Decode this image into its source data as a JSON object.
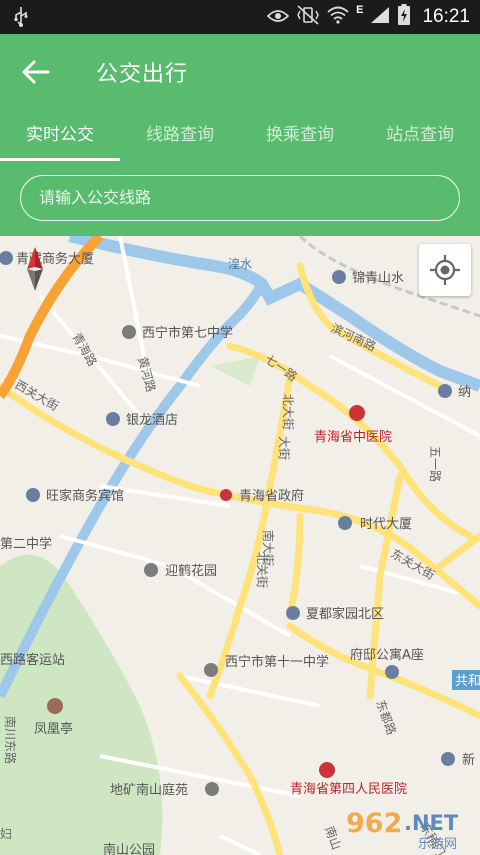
{
  "status_bar": {
    "time": "16:21",
    "network_label": "E",
    "icons": [
      "usb-icon",
      "eye-icon",
      "vibrate-icon",
      "wifi-icon",
      "signal-icon",
      "battery-charging-icon"
    ]
  },
  "header": {
    "back_icon": "back-arrow-icon",
    "title": "公交出行"
  },
  "tabs": [
    {
      "label": "实时公交",
      "active": true
    },
    {
      "label": "线路查询",
      "active": false
    },
    {
      "label": "换乘查询",
      "active": false
    },
    {
      "label": "站点查询",
      "active": false
    }
  ],
  "search": {
    "value": "",
    "placeholder": "请输入公交线路"
  },
  "map": {
    "locate_icon": "gps-locate-icon",
    "compass_icon": "compass-icon",
    "pois": [
      {
        "name": "青藏商务大厦",
        "type": "building"
      },
      {
        "name": "锦青山水",
        "type": "building"
      },
      {
        "name": "西宁市第七中学",
        "type": "school"
      },
      {
        "name": "银龙酒店",
        "type": "hotel"
      },
      {
        "name": "纳",
        "type": "hotel"
      },
      {
        "name": "青海省中医院",
        "type": "hospital"
      },
      {
        "name": "旺家商务宾馆",
        "type": "hotel"
      },
      {
        "name": "青海省政府",
        "type": "government"
      },
      {
        "name": "时代大厦",
        "type": "building"
      },
      {
        "name": "第二中学",
        "type": "school"
      },
      {
        "name": "迎鹤花园",
        "type": "residential"
      },
      {
        "name": "夏都家园北区",
        "type": "residential"
      },
      {
        "name": "府邸公寓A座",
        "type": "residential"
      },
      {
        "name": "西宁市第十一中学",
        "type": "school"
      },
      {
        "name": "西路客运站",
        "type": "station"
      },
      {
        "name": "凤凰亭",
        "type": "scenic"
      },
      {
        "name": "地矿南山庭苑",
        "type": "residential"
      },
      {
        "name": "青海省第四人民医院",
        "type": "hospital"
      },
      {
        "name": "南山公园",
        "type": "park"
      },
      {
        "name": "新",
        "type": "residential"
      },
      {
        "name": "共和",
        "type": "road-sign"
      }
    ],
    "roads": [
      "湟水",
      "滨河南路",
      "七一路",
      "北大街",
      "南大街",
      "五一路",
      "西关大街",
      "东关大街",
      "东稍门",
      "南川东路",
      "东都路",
      "黄河路",
      "青海路",
      "北关街",
      "大街",
      "南山",
      "妇"
    ],
    "colors": {
      "land": "#f2efe9",
      "water": "#9ec8ea",
      "green": "#cfe6c3",
      "main_road": "#ffe27a",
      "highway": "#f7a234",
      "minor_road": "#ffffff"
    }
  },
  "watermark": {
    "brand": "962",
    "domain": ".NET",
    "site": "乐游网"
  }
}
